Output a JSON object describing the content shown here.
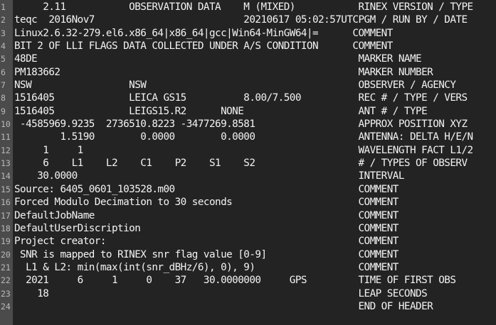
{
  "editor": {
    "lines": [
      {
        "num": "1",
        "text": "     2.11           OBSERVATION DATA    M (MIXED)           RINEX VERSION / TYPE"
      },
      {
        "num": "2",
        "text": "teqc  2016Nov7                          20210617 05:02:57UTCPGM / RUN BY / DATE"
      },
      {
        "num": "3",
        "text": "Linux2.6.32-279.el6.x86_64|x86_64|gcc|Win64-MinGW64|=      COMMENT"
      },
      {
        "num": "4",
        "text": "BIT 2 OF LLI FLAGS DATA COLLECTED UNDER A/S CONDITION      COMMENT"
      },
      {
        "num": "5",
        "text": "48DE                                                        MARKER NAME"
      },
      {
        "num": "6",
        "text": "PM183662                                                    MARKER NUMBER"
      },
      {
        "num": "7",
        "text": "NSW                 NSW                                     OBSERVER / AGENCY"
      },
      {
        "num": "8",
        "text": "1516405             LEICA GS15          8.00/7.500          REC # / TYPE / VERS"
      },
      {
        "num": "9",
        "text": "1516405             LEIGS15.R2      NONE                    ANT # / TYPE"
      },
      {
        "num": "10",
        "text": " -4585969.9235  2736510.8223 -3477269.8581                  APPROX POSITION XYZ"
      },
      {
        "num": "11",
        "text": "        1.5190        0.0000        0.0000                  ANTENNA: DELTA H/E/N"
      },
      {
        "num": "12",
        "text": "     1     1                                                WAVELENGTH FACT L1/2"
      },
      {
        "num": "13",
        "text": "     6    L1    L2    C1    P2    S1    S2                  # / TYPES OF OBSERV"
      },
      {
        "num": "14",
        "text": "    30.0000                                                 INTERVAL"
      },
      {
        "num": "15",
        "text": "Source: 6405_0601_103528.m00                                COMMENT"
      },
      {
        "num": "16",
        "text": "Forced Modulo Decimation to 30 seconds                      COMMENT"
      },
      {
        "num": "17",
        "text": "DefaultJobName                                              COMMENT"
      },
      {
        "num": "18",
        "text": "DefaultUserDiscription                                      COMMENT"
      },
      {
        "num": "19",
        "text": "Project creator:                                            COMMENT"
      },
      {
        "num": "20",
        "text": " SNR is mapped to RINEX snr flag value [0-9]                COMMENT"
      },
      {
        "num": "21",
        "text": "  L1 & L2: min(max(int(snr_dBHz/6), 0), 9)                  COMMENT"
      },
      {
        "num": "22",
        "text": "  2021     6     1     0    37   30.0000000     GPS         TIME OF FIRST OBS"
      },
      {
        "num": "23",
        "text": "    18                                                      LEAP SECONDS"
      },
      {
        "num": "24",
        "text": "                                                            END OF HEADER"
      }
    ]
  }
}
